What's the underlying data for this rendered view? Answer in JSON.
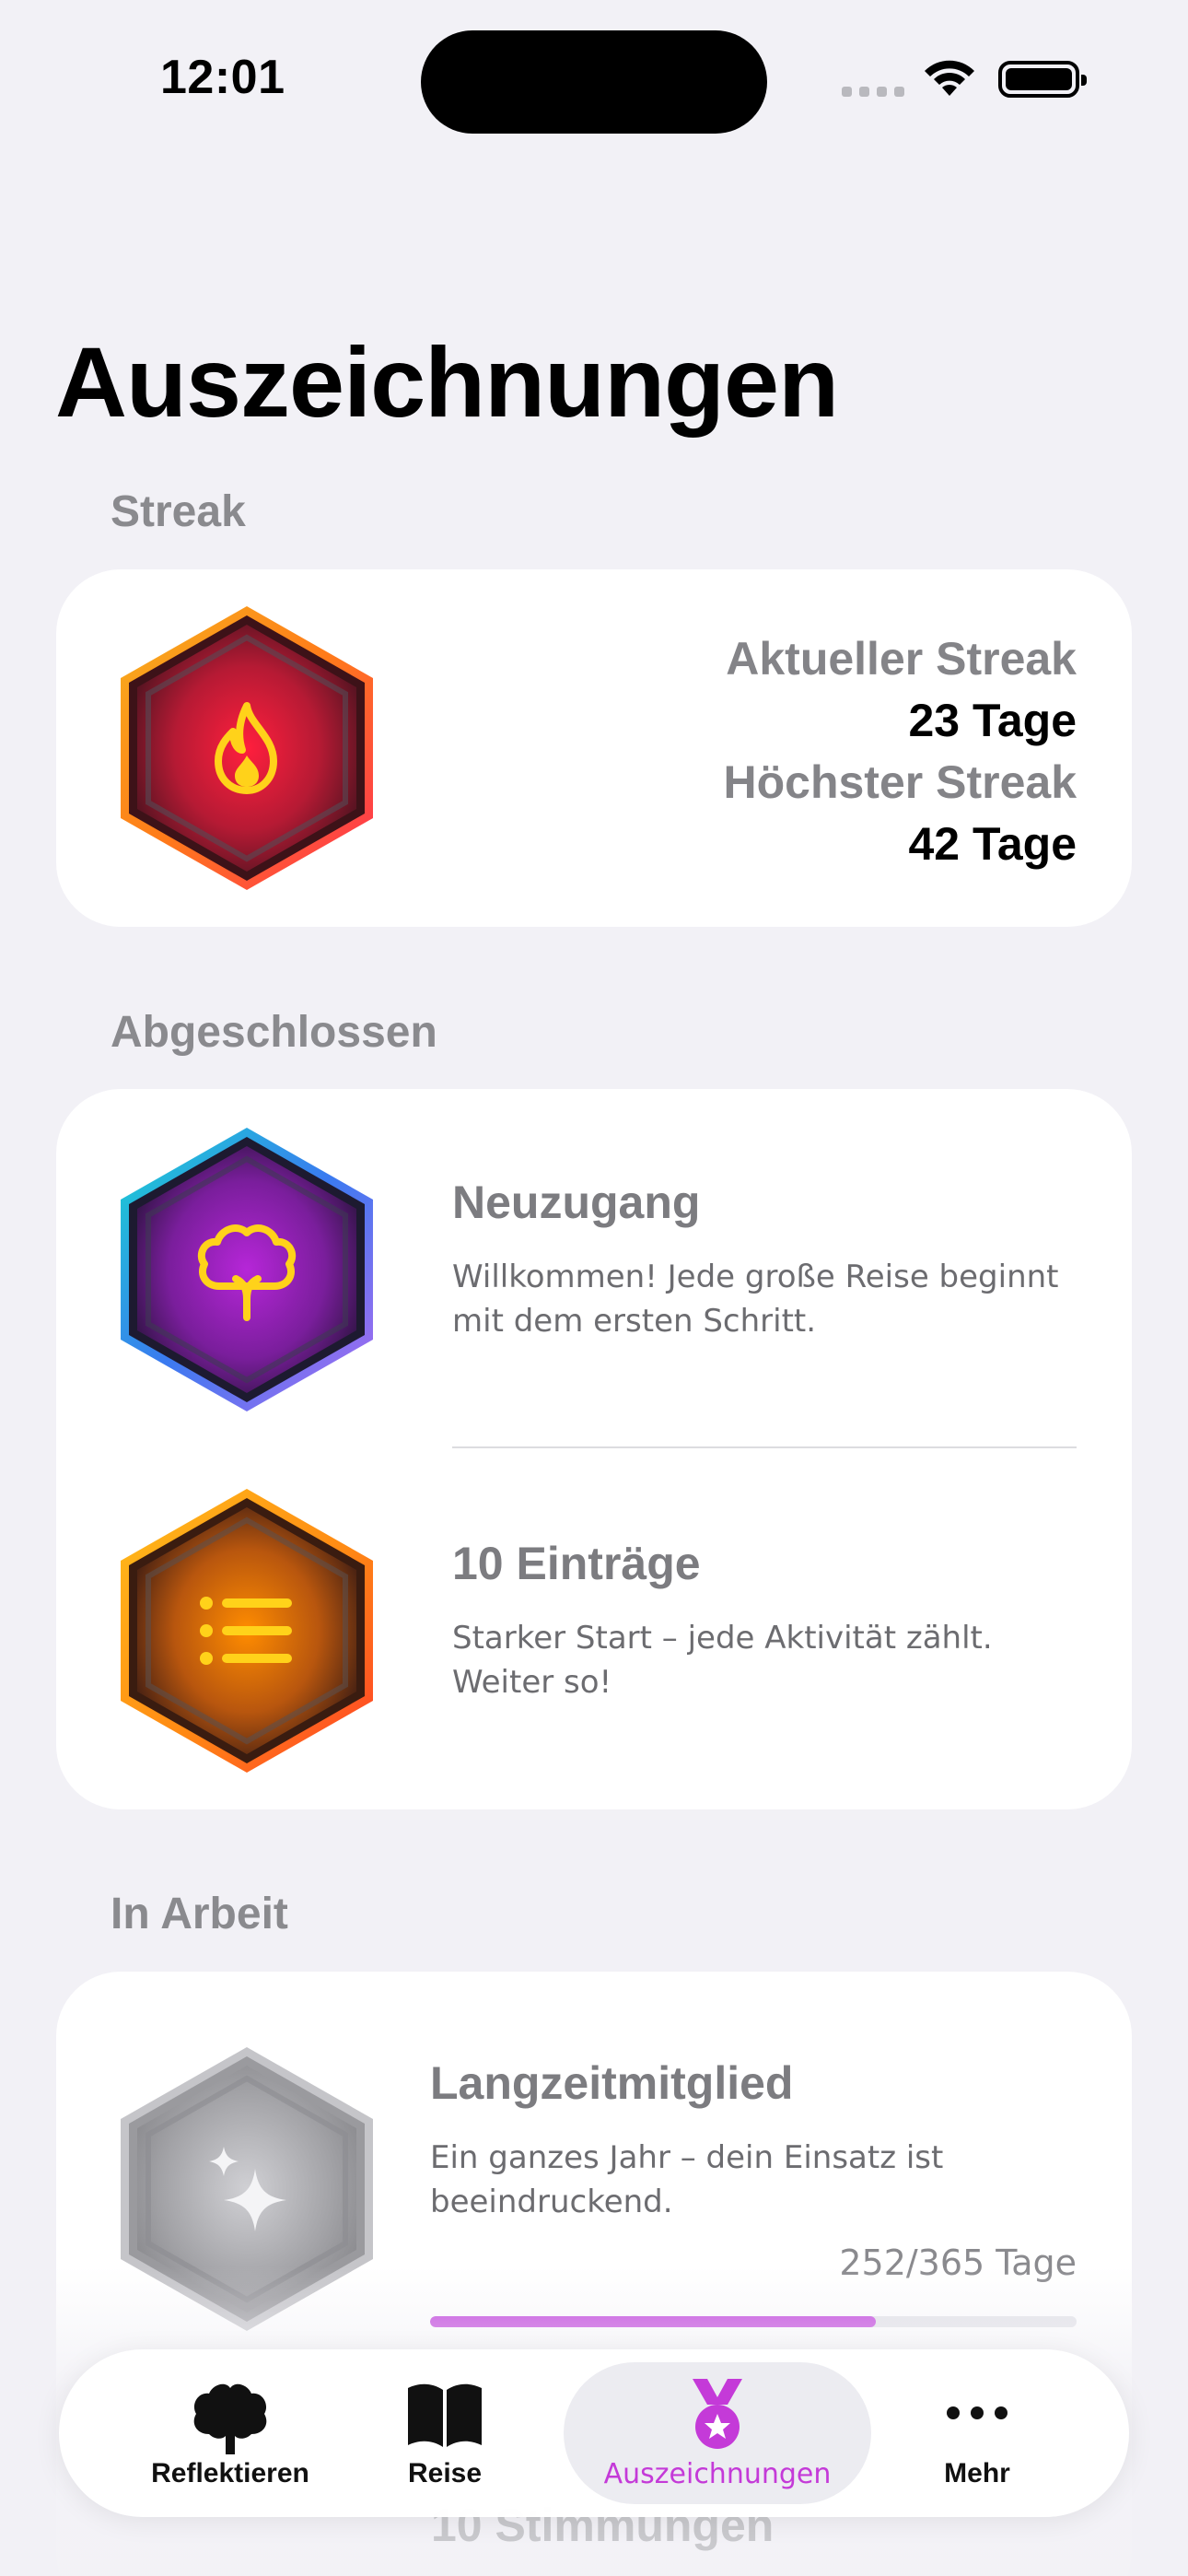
{
  "status_bar": {
    "time": "12:01"
  },
  "page": {
    "title": "Auszeichnungen"
  },
  "streak": {
    "section_label": "Streak",
    "current_label": "Aktueller Streak",
    "current_value": "23 Tage",
    "best_label": "Höchster Streak",
    "best_value": "42 Tage",
    "badge_icon": "flame-icon"
  },
  "completed": {
    "section_label": "Abgeschlossen",
    "items": [
      {
        "title": "Neuzugang",
        "description": "Willkommen! Jede große Reise beginnt mit dem ersten Schritt.",
        "icon": "tree-icon"
      },
      {
        "title": "10 Einträge",
        "description": "Starker Start – jede Aktivität zählt. Weiter so!",
        "icon": "list-icon"
      }
    ]
  },
  "in_progress": {
    "section_label": "In Arbeit",
    "items": [
      {
        "title": "Langzeitmitglied",
        "description": "Ein ganzes Jahr – dein Einsatz ist beeindruckend.",
        "progress_text": "252/365 Tage",
        "progress_fraction": 0.69,
        "icon": "sparkles-icon"
      },
      {
        "title": "10 Stimmungen"
      }
    ]
  },
  "tab_bar": {
    "tabs": [
      {
        "label": "Reflektieren",
        "icon": "tree-icon"
      },
      {
        "label": "Reise",
        "icon": "book-icon"
      },
      {
        "label": "Auszeichnungen",
        "icon": "medal-icon",
        "active": true
      },
      {
        "label": "Mehr",
        "icon": "ellipsis-icon"
      }
    ]
  },
  "colors": {
    "accent": "#c03bdc",
    "background": "#f2f1f6",
    "streak_badge": "#e8203a",
    "newcomer_badge": "#b02fd0",
    "entries_badge": "#f08a10",
    "locked_badge": "#a9a9ad"
  }
}
